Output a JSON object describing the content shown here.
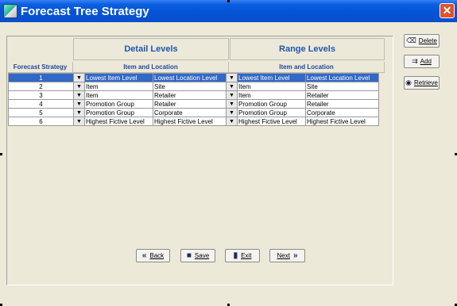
{
  "window": {
    "title": "Forecast Tree Strategy",
    "close_label": "✕"
  },
  "groups": {
    "detail": "Detail Levels",
    "range": "Range Levels"
  },
  "columns": {
    "strategy": "Forecast Strategy",
    "detail_item_loc": "Item and Location",
    "range_item_loc": "Item and Location"
  },
  "rows": [
    {
      "num": "1",
      "d_item": "Lowest Item Level",
      "d_loc": "Lowest Location Level",
      "r_item": "Lowest Item Level",
      "r_loc": "Lowest Location Level"
    },
    {
      "num": "2",
      "d_item": "Item",
      "d_loc": "Site",
      "r_item": "Item",
      "r_loc": "Site"
    },
    {
      "num": "3",
      "d_item": "Item",
      "d_loc": "Retailer",
      "r_item": "Item",
      "r_loc": "Retailer"
    },
    {
      "num": "4",
      "d_item": "Promotion Group",
      "d_loc": "Retailer",
      "r_item": "Promotion Group",
      "r_loc": "Retailer"
    },
    {
      "num": "5",
      "d_item": "Promotion Group",
      "d_loc": "Corporate",
      "r_item": "Promotion Group",
      "r_loc": "Corporate"
    },
    {
      "num": "6",
      "d_item": "Highest Fictive Level",
      "d_loc": "Highest Fictive Level",
      "r_item": "Highest Fictive Level",
      "r_loc": "Highest Fictive Level"
    }
  ],
  "side_buttons": {
    "delete": "Delete",
    "add": "Add",
    "retrieve": "Retrieve"
  },
  "bottom_buttons": {
    "back": "Back",
    "save": "Save",
    "exit": "Exit",
    "next": "Next"
  },
  "icons": {
    "back": "back-arrows-icon",
    "save": "floppy-disk-icon",
    "exit": "exit-door-icon",
    "next": "next-arrows-icon",
    "delete": "eraser-icon",
    "add": "add-row-icon",
    "retrieve": "retrieve-globe-icon"
  },
  "colors": {
    "selected_row": "#3169c6",
    "title_bar": "#0553d6",
    "header_text": "#2255b0",
    "background": "#ECE9D8"
  }
}
